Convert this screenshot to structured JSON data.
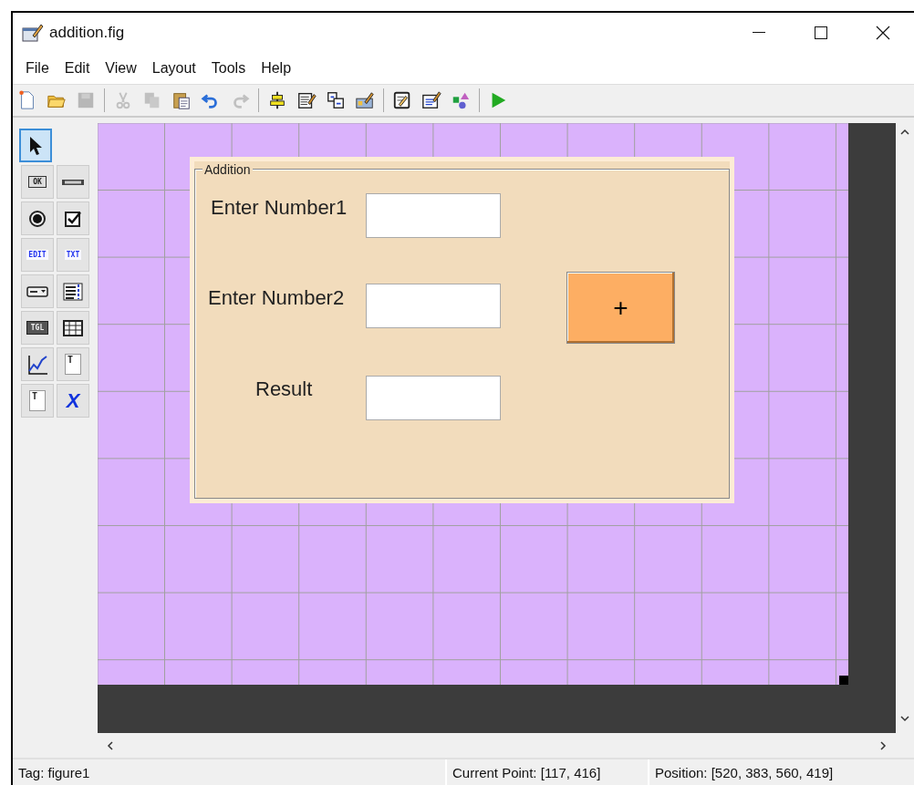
{
  "window": {
    "title": "addition.fig"
  },
  "menu": [
    "File",
    "Edit",
    "View",
    "Layout",
    "Tools",
    "Help"
  ],
  "toolbar": [
    {
      "kind": "new",
      "disabled": false
    },
    {
      "kind": "open",
      "disabled": false
    },
    {
      "kind": "save",
      "disabled": true
    },
    {
      "kind": "separator"
    },
    {
      "kind": "cut",
      "disabled": true
    },
    {
      "kind": "copy",
      "disabled": true
    },
    {
      "kind": "paste",
      "disabled": false
    },
    {
      "kind": "undo",
      "disabled": false
    },
    {
      "kind": "redo",
      "disabled": true
    },
    {
      "kind": "separator"
    },
    {
      "kind": "align",
      "disabled": false
    },
    {
      "kind": "menu-editor",
      "disabled": false
    },
    {
      "kind": "tab-order",
      "disabled": false
    },
    {
      "kind": "toolbar-editor",
      "disabled": false
    },
    {
      "kind": "separator"
    },
    {
      "kind": "editor",
      "disabled": false
    },
    {
      "kind": "inspector",
      "disabled": false
    },
    {
      "kind": "browser",
      "disabled": false
    },
    {
      "kind": "separator"
    },
    {
      "kind": "run",
      "disabled": false
    }
  ],
  "palette": [
    {
      "kind": "pointer",
      "selected": true
    },
    {
      "kind": "pushbutton",
      "text": "OK",
      "selected": false
    },
    {
      "kind": "slider",
      "selected": false
    },
    {
      "kind": "radio",
      "selected": false
    },
    {
      "kind": "checkbox",
      "selected": false
    },
    {
      "kind": "edit",
      "text": "EDIT",
      "selected": false
    },
    {
      "kind": "statictext",
      "text": "TXT",
      "selected": false
    },
    {
      "kind": "popup",
      "selected": false
    },
    {
      "kind": "listbox",
      "selected": false
    },
    {
      "kind": "toggle",
      "text": "TGL",
      "selected": false
    },
    {
      "kind": "table",
      "selected": false
    },
    {
      "kind": "axes",
      "selected": false
    },
    {
      "kind": "panel",
      "text": "T",
      "selected": false
    },
    {
      "kind": "buttongroup",
      "text": "T",
      "selected": false
    },
    {
      "kind": "activex",
      "text": "X",
      "selected": false
    }
  ],
  "panel": {
    "title": "Addition",
    "fields": [
      {
        "label": "Enter Number1"
      },
      {
        "label": "Enter Number2"
      },
      {
        "label": "Result"
      }
    ],
    "button": {
      "label": "+"
    }
  },
  "status_bar": {
    "tag": "Tag: figure1",
    "current_point": "Current Point:  [117, 416]",
    "position": "Position: [520, 383, 560, 419]"
  }
}
